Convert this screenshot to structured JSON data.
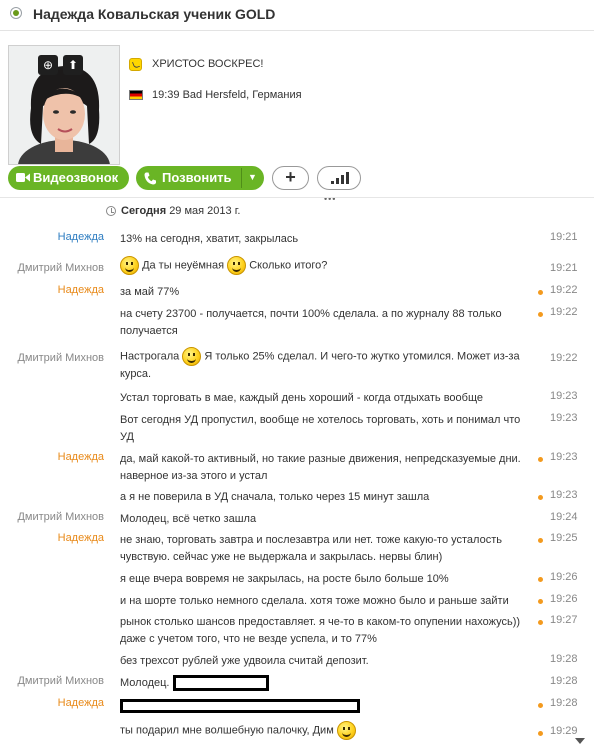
{
  "header": {
    "title": "Надежда Ковальская ученик GOLD"
  },
  "profile": {
    "mood": "ХРИСТОС ВОСКРЕС!",
    "location": "19:39 Bad Hersfeld, Германия",
    "country_flag": "Germany",
    "buttons": {
      "video": "Видеозвонок",
      "call": "Позвонить",
      "add": "+"
    }
  },
  "colors": {
    "accent_green": "#6ab525",
    "sender_blue": "#2e7dc1",
    "sender_orange": "#e88a1a",
    "pending_dot": "#f39a1e"
  },
  "date": {
    "label": "Сегодня",
    "value": "29 мая 2013 г."
  },
  "messages": [
    {
      "sender": "Надежда",
      "parts": [
        "13% на сегодня, хватит, закрылась"
      ],
      "time": "19:21"
    },
    {
      "sender": "Дмитрий Михнов",
      "parts": [
        "Да ты неуёмная",
        "Сколько итого?"
      ],
      "time": "19:21"
    },
    {
      "sender": "Надежда",
      "parts": [
        "за май 77%"
      ],
      "time": "19:22"
    },
    {
      "sender": "",
      "parts": [
        "на счету 23700 - получается, почти 100% сделала. а по журналу 88 только получается"
      ],
      "time": "19:22"
    },
    {
      "sender": "Дмитрий Михнов",
      "parts": [
        "Настрогала",
        "Я только 25% сделал. И чего-то жутко утомился. Может из-за курса."
      ],
      "time": "19:22"
    },
    {
      "sender": "",
      "parts": [
        "Устал торговать в мае, каждый день хороший - когда отдыхать вообще"
      ],
      "time": "19:23"
    },
    {
      "sender": "",
      "parts": [
        "Вот сегодня УД пропустил, вообще не хотелось торговать, хоть и понимал что УД"
      ],
      "time": "19:23"
    },
    {
      "sender": "Надежда",
      "parts": [
        "да, май какой-то активный, но такие разные движения, непредсказуемые дни. наверное из-за этого и устал"
      ],
      "time": "19:23"
    },
    {
      "sender": "",
      "parts": [
        "а я не поверила в УД сначала, только через 15 минут зашла"
      ],
      "time": "19:23"
    },
    {
      "sender": "Дмитрий Михнов",
      "parts": [
        "Молодец, всё четко зашла"
      ],
      "time": "19:24"
    },
    {
      "sender": "Надежда",
      "parts": [
        "не знаю, торговать завтра и послезавтра или нет. тоже какую-то усталость чувствую. сейчас уже не выдержала и закрылась. нервы блин)"
      ],
      "time": "19:25"
    },
    {
      "sender": "",
      "parts": [
        "я еще вчера вовремя не закрылась, на росте было больше 10%"
      ],
      "time": "19:26"
    },
    {
      "sender": "",
      "parts": [
        "и на шорте только немного сделала. хотя тоже можно было и раньше зайти"
      ],
      "time": "19:26"
    },
    {
      "sender": "",
      "parts": [
        "рынок столько шансов предоставляет. я че-то в каком-то опупении нахожусь)) даже с учетом того, что не везде успела, и то 77%"
      ],
      "time": "19:27"
    },
    {
      "sender": "",
      "parts": [
        "без трехсот рублей уже удвоила считай депозит."
      ],
      "time": "19:28"
    },
    {
      "sender": "Дмитрий Михнов",
      "parts": [
        "Молодец."
      ],
      "time": "19:28"
    },
    {
      "sender": "Надежда",
      "parts": [
        ""
      ],
      "time": "19:28"
    },
    {
      "sender": "",
      "parts": [
        "ты подарил мне волшебную палочку, Дим"
      ],
      "time": "19:29"
    }
  ]
}
